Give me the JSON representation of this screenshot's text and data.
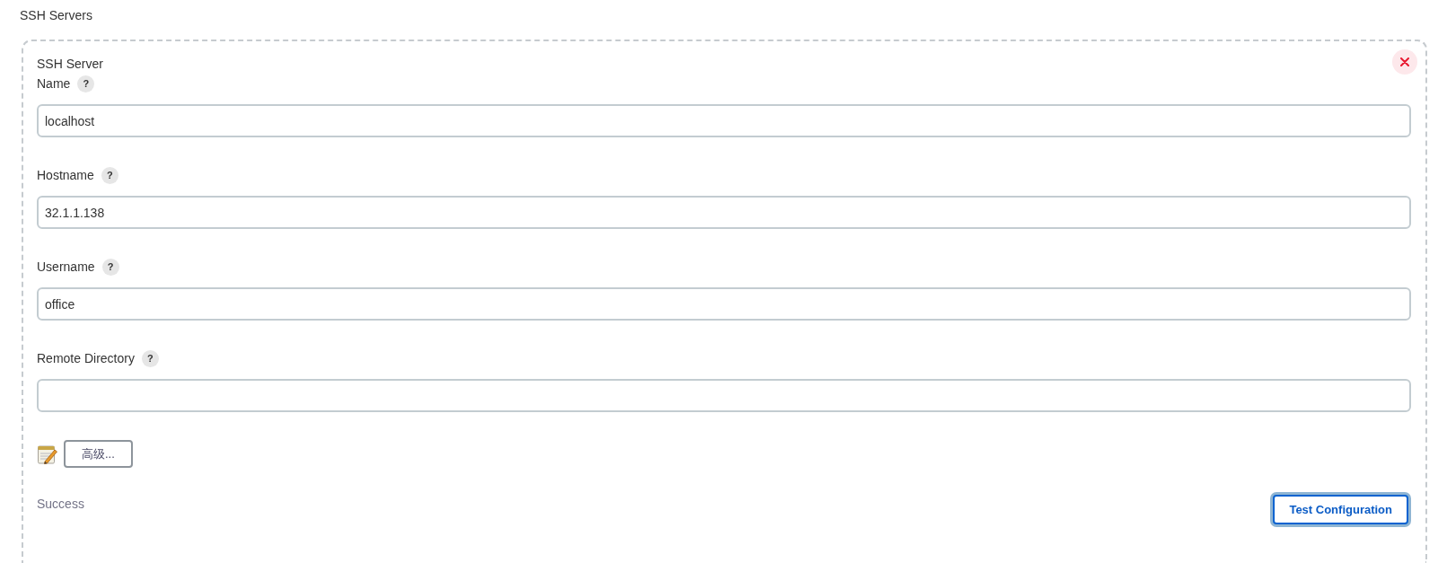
{
  "section_title": "SSH Servers",
  "server": {
    "title": "SSH Server",
    "fields": [
      {
        "label": "Name",
        "help": "?",
        "value": "localhost"
      },
      {
        "label": "Hostname",
        "help": "?",
        "value": "32.1.1.138"
      },
      {
        "label": "Username",
        "help": "?",
        "value": "office"
      },
      {
        "label": "Remote Directory",
        "help": "?"
      }
    ],
    "advanced_button": "高级...",
    "status": "Success",
    "test_button": {
      "label": "Test Configuration",
      "focused": true
    }
  }
}
